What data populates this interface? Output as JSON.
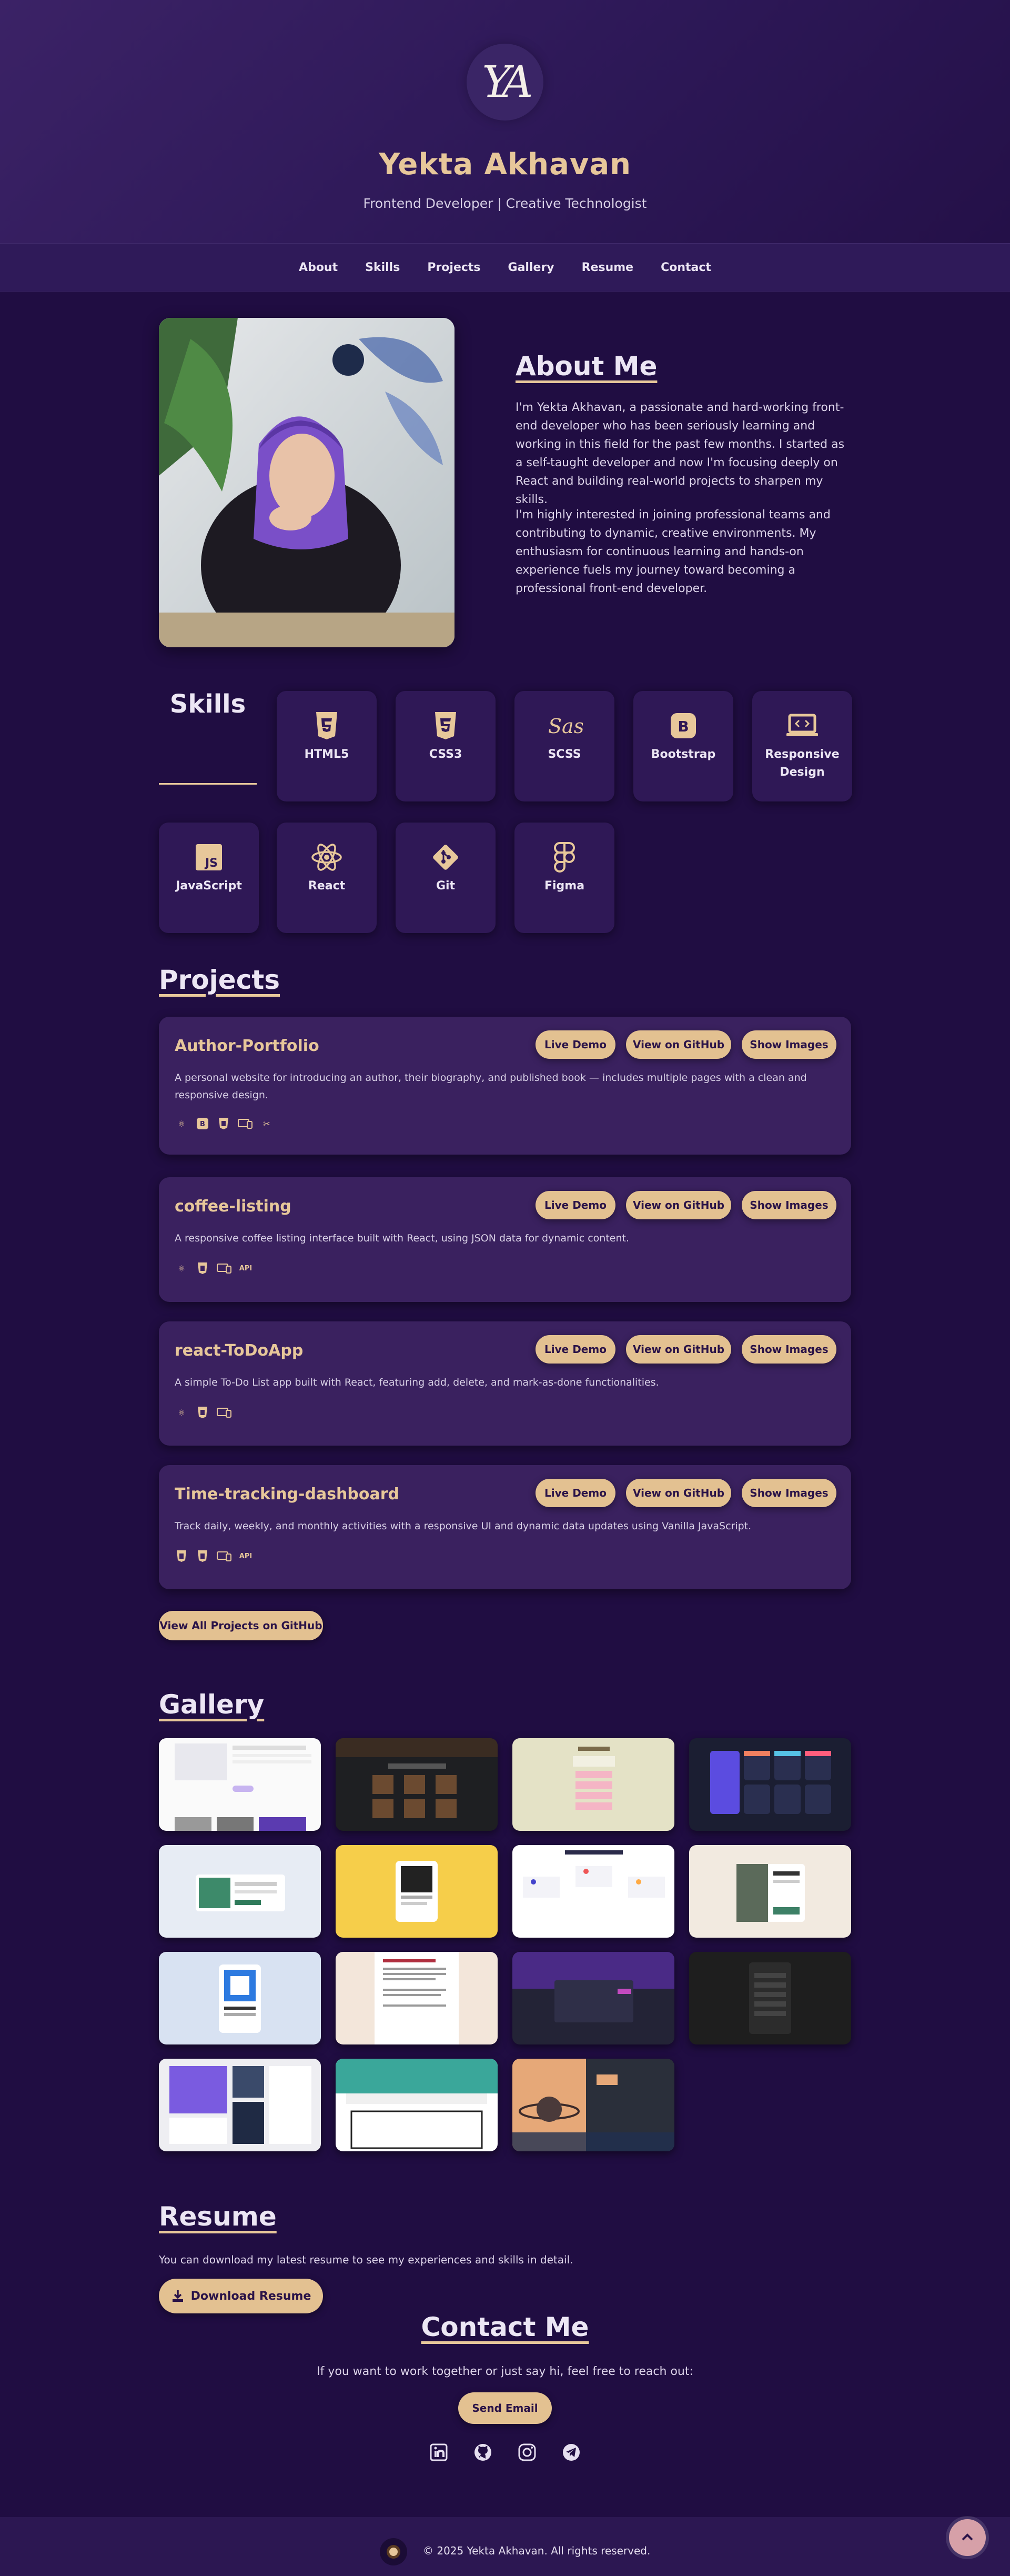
{
  "header": {
    "logo_text": "YA",
    "title": "Yekta Akhavan",
    "subtitle": "Frontend Developer | Creative Technologist"
  },
  "nav": [
    "About",
    "Skills",
    "Projects",
    "Gallery",
    "Resume",
    "Contact"
  ],
  "about": {
    "heading": "About Me",
    "paragraphs": [
      "I'm Yekta Akhavan, a passionate and hard-working front-end developer who has been seriously learning and working in this field for the past few months. I started as a self-taught developer and now I'm focusing deeply on React and building real-world projects to sharpen my skills.",
      "I'm highly interested in joining professional teams and contributing to dynamic, creative environments. My enthusiasm for continuous learning and hands-on experience fuels my journey toward becoming a professional front-end developer."
    ]
  },
  "skills": {
    "heading": "Skills",
    "items": [
      {
        "label": "HTML5",
        "icon": "html5-icon"
      },
      {
        "label": "CSS3",
        "icon": "css3-icon"
      },
      {
        "label": "SCSS",
        "icon": "sass-icon"
      },
      {
        "label": "Bootstrap",
        "icon": "bootstrap-icon"
      },
      {
        "label": "Responsive Design",
        "icon": "responsive-icon"
      },
      {
        "label": "JavaScript",
        "icon": "javascript-icon"
      },
      {
        "label": "React",
        "icon": "react-icon"
      },
      {
        "label": "Git",
        "icon": "git-icon"
      },
      {
        "label": "Figma",
        "icon": "figma-icon"
      }
    ]
  },
  "projects": {
    "heading": "Projects",
    "buttons": {
      "demo": "Live Demo",
      "github": "View on GitHub",
      "images": "Show Images"
    },
    "items": [
      {
        "title": "Author-Portfolio",
        "desc": "A personal website for introducing an author, their biography, and published book — includes multiple pages with a clean and responsive design.",
        "tags": [
          "react-icon",
          "bootstrap-icon",
          "css3-icon",
          "responsive-icon",
          "tools-icon"
        ]
      },
      {
        "title": "coffee-listing",
        "desc": "A responsive coffee listing interface built with React, using JSON data for dynamic content.",
        "tags": [
          "react-icon",
          "css3-icon",
          "responsive-icon",
          "api"
        ]
      },
      {
        "title": "react-ToDoApp",
        "desc": "A simple To-Do List app built with React, featuring add, delete, and mark-as-done functionalities.",
        "tags": [
          "react-icon",
          "css3-icon",
          "responsive-icon"
        ]
      },
      {
        "title": "Time-tracking-dashboard",
        "desc": "Track daily, weekly, and monthly activities with a responsive UI and dynamic data updates using Vanilla JavaScript.",
        "tags": [
          "html5-icon",
          "css3-icon",
          "responsive-icon",
          "api"
        ]
      }
    ],
    "api_label": "API",
    "all_button": "View All Projects on GitHub"
  },
  "gallery": {
    "heading": "Gallery"
  },
  "resume": {
    "heading": "Resume",
    "text": "You can download my latest resume to see my experiences and skills in detail.",
    "button": "Download Resume"
  },
  "contact": {
    "heading": "Contact Me",
    "text": "If you want to work together or just say hi, feel free to reach out:",
    "button": "Send Email",
    "socials": [
      "linkedin-icon",
      "github-icon",
      "instagram-icon",
      "telegram-icon"
    ]
  },
  "footer": {
    "text": "© 2025 Yekta Akhavan. All rights reserved."
  },
  "colors": {
    "background": "#200d42",
    "accent": "#e7c79a",
    "card": "#3a215f"
  }
}
